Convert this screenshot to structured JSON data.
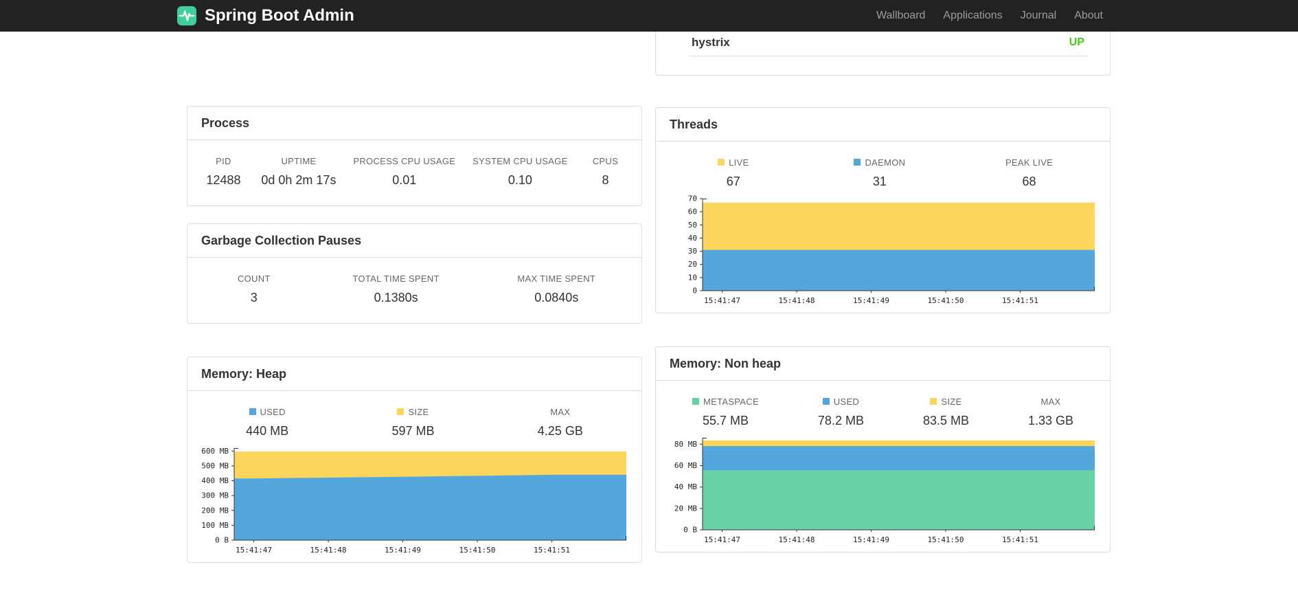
{
  "navbar": {
    "brand": "Spring Boot Admin",
    "links": [
      "Wallboard",
      "Applications",
      "Journal",
      "About"
    ]
  },
  "status_panel": {
    "application": "hystrix",
    "status": "UP",
    "status_color": "#44cc11"
  },
  "panels": {
    "process": {
      "title": "Process",
      "stats": [
        {
          "label": "PID",
          "value": "12488"
        },
        {
          "label": "UPTIME",
          "value": "0d 0h 2m 17s"
        },
        {
          "label": "PROCESS CPU USAGE",
          "value": "0.01"
        },
        {
          "label": "SYSTEM CPU USAGE",
          "value": "0.10"
        },
        {
          "label": "CPUS",
          "value": "8"
        }
      ]
    },
    "gc": {
      "title": "Garbage Collection Pauses",
      "stats": [
        {
          "label": "COUNT",
          "value": "3"
        },
        {
          "label": "TOTAL TIME SPENT",
          "value": "0.1380s"
        },
        {
          "label": "MAX TIME SPENT",
          "value": "0.0840s"
        }
      ]
    },
    "threads": {
      "title": "Threads",
      "legend": [
        {
          "label": "LIVE",
          "value": "67",
          "color": "#fbd55c"
        },
        {
          "label": "DAEMON",
          "value": "31",
          "color": "#53a7dc"
        },
        {
          "label": "PEAK LIVE",
          "value": "68"
        }
      ]
    },
    "heap": {
      "title": "Memory: Heap",
      "legend": [
        {
          "label": "USED",
          "value": "440 MB",
          "color": "#53a7dc"
        },
        {
          "label": "SIZE",
          "value": "597 MB",
          "color": "#fbd55c"
        },
        {
          "label": "MAX",
          "value": "4.25 GB"
        }
      ]
    },
    "nonheap": {
      "title": "Memory: Non heap",
      "legend": [
        {
          "label": "METASPACE",
          "value": "55.7 MB",
          "color": "#68d0a5"
        },
        {
          "label": "USED",
          "value": "78.2 MB",
          "color": "#53a7dc"
        },
        {
          "label": "SIZE",
          "value": "83.5 MB",
          "color": "#fbd55c"
        },
        {
          "label": "MAX",
          "value": "1.33 GB"
        }
      ]
    }
  },
  "chart_data": [
    {
      "id": "threads",
      "type": "area",
      "title": "Threads",
      "x": [
        "15:41:47",
        "15:41:48",
        "15:41:49",
        "15:41:50",
        "15:41:51"
      ],
      "ylim": [
        0,
        70
      ],
      "grid": false,
      "legend_position": "top",
      "y_ticks": [
        {
          "v": 0,
          "label": "0"
        },
        {
          "v": 10,
          "label": "10"
        },
        {
          "v": 20,
          "label": "20"
        },
        {
          "v": 30,
          "label": "30"
        },
        {
          "v": 40,
          "label": "40"
        },
        {
          "v": 50,
          "label": "50"
        },
        {
          "v": 60,
          "label": "60"
        },
        {
          "v": 70,
          "label": "70"
        }
      ],
      "series": [
        {
          "name": "LIVE",
          "color": "#fbd55c",
          "values": [
            67,
            67,
            67,
            67,
            67
          ]
        },
        {
          "name": "DAEMON",
          "color": "#53a7dc",
          "values": [
            31,
            31,
            31,
            31,
            31
          ]
        }
      ]
    },
    {
      "id": "memory-heap",
      "type": "area",
      "title": "Memory: Heap",
      "x": [
        "15:41:47",
        "15:41:48",
        "15:41:49",
        "15:41:50",
        "15:41:51"
      ],
      "ylim": [
        0,
        620
      ],
      "unit": "MB",
      "grid": false,
      "legend_position": "top",
      "y_ticks": [
        {
          "v": 0,
          "label": "0 B"
        },
        {
          "v": 100,
          "label": "100 MB"
        },
        {
          "v": 200,
          "label": "200 MB"
        },
        {
          "v": 300,
          "label": "300 MB"
        },
        {
          "v": 400,
          "label": "400 MB"
        },
        {
          "v": 500,
          "label": "500 MB"
        },
        {
          "v": 600,
          "label": "600 MB"
        }
      ],
      "series": [
        {
          "name": "SIZE",
          "color": "#fbd55c",
          "values": [
            597,
            597,
            597,
            597,
            597
          ]
        },
        {
          "name": "USED",
          "color": "#53a7dc",
          "values": [
            415,
            421,
            427,
            433,
            440
          ]
        }
      ]
    },
    {
      "id": "memory-nonheap",
      "type": "area",
      "title": "Memory: Non heap",
      "x": [
        "15:41:47",
        "15:41:48",
        "15:41:49",
        "15:41:50",
        "15:41:51"
      ],
      "ylim": [
        0,
        86
      ],
      "unit": "MB",
      "grid": false,
      "legend_position": "top",
      "y_ticks": [
        {
          "v": 0,
          "label": "0 B"
        },
        {
          "v": 20,
          "label": "20 MB"
        },
        {
          "v": 40,
          "label": "40 MB"
        },
        {
          "v": 60,
          "label": "60 MB"
        },
        {
          "v": 80,
          "label": "80 MB"
        }
      ],
      "series": [
        {
          "name": "SIZE",
          "color": "#fbd55c",
          "values": [
            83.5,
            83.5,
            83.5,
            83.5,
            83.5
          ]
        },
        {
          "name": "USED",
          "color": "#53a7dc",
          "values": [
            78.2,
            78.2,
            78.2,
            78.2,
            78.2
          ]
        },
        {
          "name": "METASPACE",
          "color": "#68d0a5",
          "values": [
            55.7,
            55.7,
            55.7,
            55.7,
            55.7
          ]
        }
      ]
    }
  ]
}
